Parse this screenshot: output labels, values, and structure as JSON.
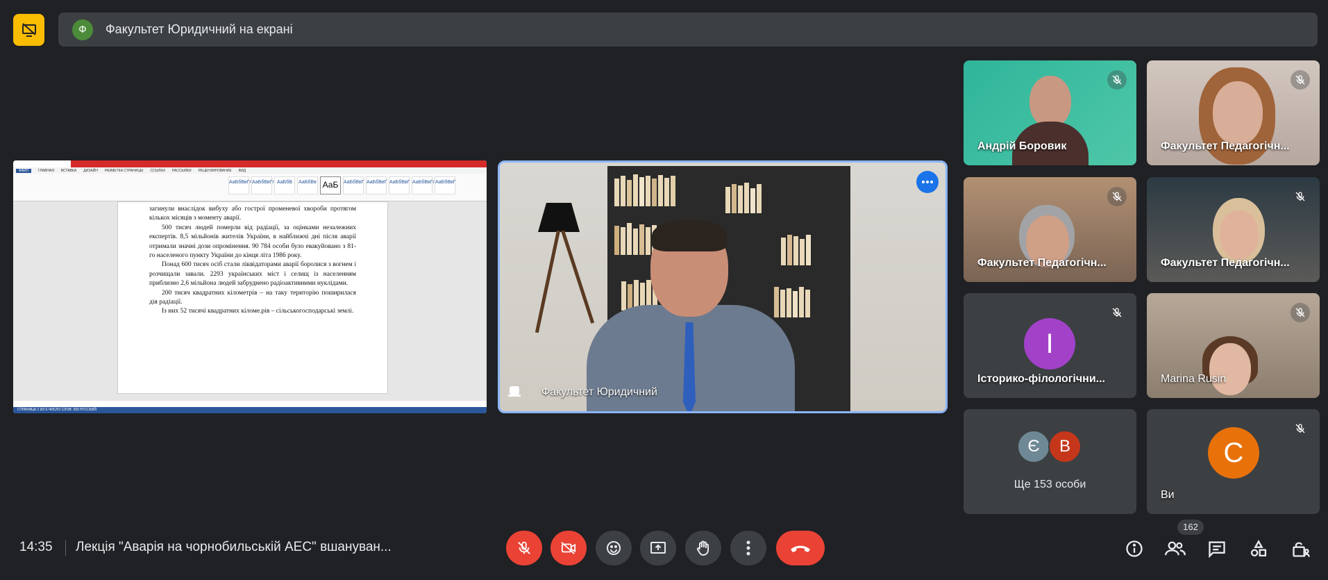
{
  "banner": {
    "avatar_letter": "Ф",
    "avatar_color": "#4c8b3a",
    "text": "Факультет Юридичний на екрані"
  },
  "presentation": {
    "document": {
      "window_title": "чорнобиль2021 - Word (Сбой активации продукта)",
      "tabs": [
        "ФАЙЛ",
        "ГЛАВНАЯ",
        "ВСТАВКА",
        "ДИЗАЙН",
        "РАЗМЕТКА СТРАНИЦЫ",
        "ССЫЛКИ",
        "РАССЫЛКИ",
        "РЕЦЕНЗИРОВАНИЕ",
        "ВИД"
      ],
      "styles": [
        "АаБбВвГг",
        "АаБбВвГг",
        "АаБбВ",
        "АаБбВв",
        "АаБ",
        "АаБбВвГ",
        "АаБбВвГ",
        "АаБбВвГ",
        "АаБбВвГг",
        "АаБбВвГ"
      ],
      "paragraphs": [
        "загинули внаслідок вибуху або гострої променевої хвороби протягом кількох місяців з моменту аварії.",
        "500 тисяч людей померли від радіації, за оцінками незалежних експертів. 8,5 мільйонів жителів України, в найближчі дні після аварії отримали значні дози опромінення. 90 784 особи було евакуйовано з 81-го населеного пункту України до кінця літа 1986 року.",
        "Понад 600 тисяч осіб стали ліквідаторами аварії   боролися з вогнем і розчищали завали. 2293 українських міст і селищ із населенням приблизно 2,6 мільйона людей забруднено радіоактивними нуклідами.",
        "200 тисяч квадратних кілометрів – на таку територію поширилася дія радіації.",
        "Із них 52 тисячі квадратних кіломе.рів – сільськогосподарські землі."
      ],
      "status": "СТРАНИЦА 2 ИЗ 6    ЧИСЛО СЛОВ: 359    РУССКИЙ"
    },
    "speaker": {
      "name": "Факультет Юридичний",
      "highlight_color": "#8ab4f8"
    }
  },
  "participants": [
    {
      "name": "Андрій Боровик",
      "muted": true
    },
    {
      "name": "Факультет Педагогічн...",
      "muted": true
    },
    {
      "name": "Факультет Педагогічн...",
      "muted": true
    },
    {
      "name": "Факультет Педагогічн...",
      "muted": true
    },
    {
      "name": "Історико-філологічни...",
      "muted": true,
      "avatar_letter": "І",
      "avatar_color": "#a142c9"
    },
    {
      "name": "Marina Rusin",
      "muted": true
    }
  ],
  "more": {
    "letters": [
      "Є",
      "В"
    ],
    "colors": [
      "#6f8896",
      "#c5361b"
    ],
    "text": "Ще 153 особи"
  },
  "self": {
    "name": "Ви",
    "avatar_letter": "С",
    "avatar_color": "#e8710a",
    "muted": true
  },
  "bottom": {
    "time": "14:35",
    "meeting_title": "Лекція \"Аварія на чорнобильській АЕС\" вшануван...",
    "people_count": "162"
  },
  "controls": {
    "mic": "mic-off-icon",
    "camera": "camera-off-icon",
    "emoji": "emoji-icon",
    "present": "present-screen-icon",
    "hand": "raise-hand-icon",
    "more": "more-vert-icon",
    "end": "end-call-icon",
    "accent_red": "#ea4335"
  }
}
